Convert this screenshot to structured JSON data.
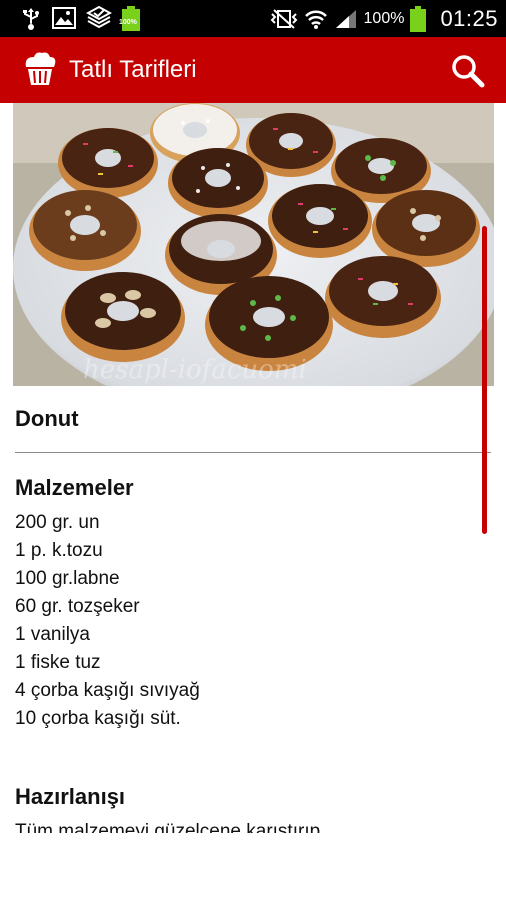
{
  "status_bar": {
    "left_icons": [
      "usb-icon",
      "image-icon",
      "checkmark-dropbox-icon",
      "battery-full-icon"
    ],
    "left_battery_label": "100%",
    "battery_percent": "100%",
    "time": "01:25",
    "right_icons": [
      "vibrate-mute-icon",
      "wifi-icon",
      "signal-icon",
      "battery-icon"
    ]
  },
  "action_bar": {
    "title": "Tatlı Tarifleri",
    "logo_icon": "cupcake-icon",
    "search_icon": "search-icon",
    "color": "#c40000"
  },
  "hero": {
    "watermark": "hesapl-iofacuomi"
  },
  "recipe": {
    "title": "Donut",
    "ingredients_heading": "Malzemeler",
    "ingredients": [
      "200 gr. un",
      "1 p. k.tozu",
      "100 gr.labne",
      "60 gr. tozşeker",
      "1 vanilya",
      "1 fiske tuz",
      "4 çorba kaşığı sıvıyağ",
      "10 çorba kaşığı süt."
    ],
    "preparation_heading": "Hazırlanışı",
    "preparation_text": "Tüm malzemeyi güzelcene karıştırıp,"
  }
}
